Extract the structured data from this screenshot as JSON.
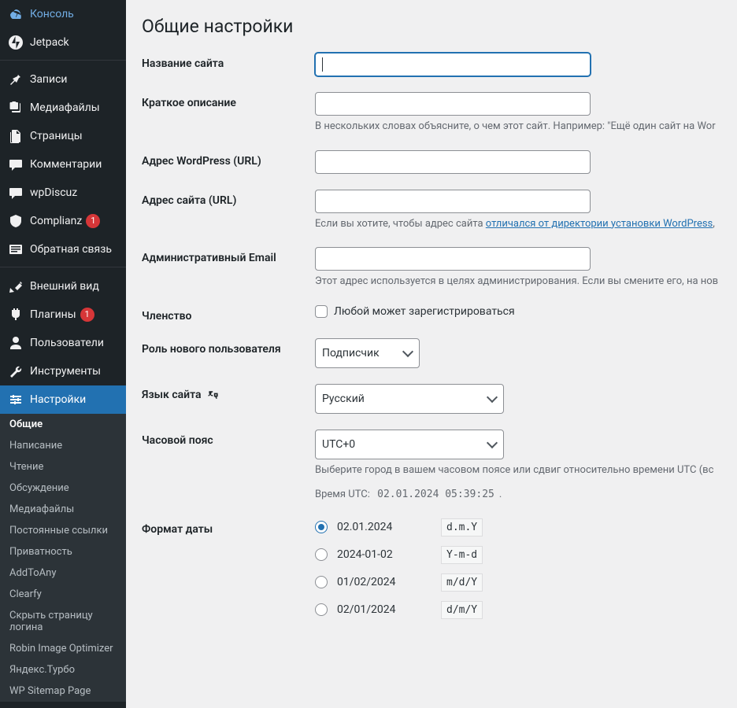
{
  "sidebar": {
    "main_menu": [
      {
        "label": "Консоль",
        "icon": "dashboard"
      },
      {
        "label": "Jetpack",
        "icon": "jetpack"
      }
    ],
    "content_menu": [
      {
        "label": "Записи",
        "icon": "pin"
      },
      {
        "label": "Медиафайлы",
        "icon": "media"
      },
      {
        "label": "Страницы",
        "icon": "pages"
      },
      {
        "label": "Комментарии",
        "icon": "comments"
      },
      {
        "label": "wpDiscuz",
        "icon": "wpdiscuz"
      },
      {
        "label": "Complianz",
        "icon": "complianz",
        "badge": "1"
      },
      {
        "label": "Обратная связь",
        "icon": "feedback"
      }
    ],
    "admin_menu": [
      {
        "label": "Внешний вид",
        "icon": "appearance"
      },
      {
        "label": "Плагины",
        "icon": "plugins",
        "badge": "1"
      },
      {
        "label": "Пользователи",
        "icon": "users"
      },
      {
        "label": "Инструменты",
        "icon": "tools"
      },
      {
        "label": "Настройки",
        "icon": "settings",
        "active": true
      }
    ],
    "submenu": [
      {
        "label": "Общие",
        "current": true
      },
      {
        "label": "Написание"
      },
      {
        "label": "Чтение"
      },
      {
        "label": "Обсуждение"
      },
      {
        "label": "Медиафайлы"
      },
      {
        "label": "Постоянные ссылки"
      },
      {
        "label": "Приватность"
      },
      {
        "label": "AddToAny"
      },
      {
        "label": "Clearfy"
      },
      {
        "label": "Скрыть страницу логина"
      },
      {
        "label": "Robin Image Optimizer"
      },
      {
        "label": "Яндекс.Турбо"
      },
      {
        "label": "WP Sitemap Page"
      }
    ]
  },
  "page": {
    "title": "Общие настройки",
    "fields": {
      "site_title_label": "Название сайта",
      "tagline_label": "Краткое описание",
      "tagline_desc": "В нескольких словах объясните, о чем этот сайт. Например: \"Ещё один сайт на Wor",
      "wp_url_label": "Адрес WordPress (URL)",
      "site_url_label": "Адрес сайта (URL)",
      "site_url_desc_pre": "Если вы хотите, чтобы адрес сайта ",
      "site_url_desc_link": "отличался от директории установки WordPress",
      "site_url_desc_post": ",",
      "admin_email_label": "Административный Email",
      "admin_email_desc": "Этот адрес используется в целях администрирования. Если вы смените его, на нов",
      "membership_label": "Членство",
      "membership_checkbox": "Любой может зарегистрироваться",
      "default_role_label": "Роль нового пользователя",
      "default_role_value": "Подписчик",
      "language_label": "Язык сайта",
      "language_value": "Русский",
      "timezone_label": "Часовой пояс",
      "timezone_value": "UTC+0",
      "timezone_desc": "Выберите город в вашем часовом поясе или сдвиг относительно времени UTC (вс",
      "utc_time_label": "Время UTC: ",
      "utc_time_value": "02.01.2024 05:39:25",
      "utc_time_dot": ".",
      "date_format_label": "Формат даты",
      "date_formats": [
        {
          "display": "02.01.2024",
          "code": "d.m.Y",
          "checked": true
        },
        {
          "display": "2024-01-02",
          "code": "Y-m-d"
        },
        {
          "display": "01/02/2024",
          "code": "m/d/Y"
        },
        {
          "display": "02/01/2024",
          "code": "d/m/Y"
        }
      ]
    }
  }
}
